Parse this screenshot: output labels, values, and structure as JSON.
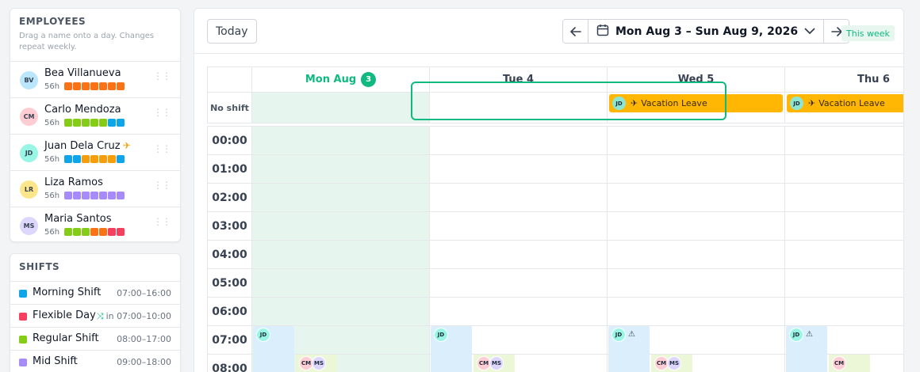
{
  "employees_panel": {
    "title": "EMPLOYEES",
    "subtitle": "Drag a name onto a day. Changes repeat weekly.",
    "items": [
      {
        "initials": "BV",
        "name": "Bea Villanueva",
        "hours": "56h",
        "avatar_color": "#bae6fd",
        "squares": [
          "#f97316",
          "#f97316",
          "#f97316",
          "#f97316",
          "#f97316",
          "#f97316",
          "#f97316"
        ],
        "on_leave": false
      },
      {
        "initials": "CM",
        "name": "Carlo Mendoza",
        "hours": "56h",
        "avatar_color": "#fecdd3",
        "squares": [
          "#84cc16",
          "#84cc16",
          "#84cc16",
          "#84cc16",
          "#84cc16",
          "#0ea5e9",
          "#0ea5e9"
        ],
        "on_leave": false
      },
      {
        "initials": "JD",
        "name": "Juan Dela Cruz",
        "hours": "56h",
        "avatar_color": "#99f6e4",
        "squares": [
          "#0ea5e9",
          "#0ea5e9",
          "#f59e0b",
          "#f59e0b",
          "#f59e0b",
          "#f59e0b",
          "#0ea5e9"
        ],
        "on_leave": true
      },
      {
        "initials": "LR",
        "name": "Liza Ramos",
        "hours": "56h",
        "avatar_color": "#fde68a",
        "squares": [
          "#a78bfa",
          "#a78bfa",
          "#a78bfa",
          "#a78bfa",
          "#a78bfa",
          "#a78bfa",
          "#a78bfa"
        ],
        "on_leave": false
      },
      {
        "initials": "MS",
        "name": "Maria Santos",
        "hours": "56h",
        "avatar_color": "#ddd6fe",
        "squares": [
          "#84cc16",
          "#84cc16",
          "#84cc16",
          "#f97316",
          "#f97316",
          "#f43f5e",
          "#f43f5e"
        ],
        "on_leave": false
      }
    ]
  },
  "shifts_panel": {
    "title": "SHIFTS",
    "items": [
      {
        "name": "Morning Shift",
        "time": "07:00–16:00",
        "color": "#0ea5e9",
        "flexible": false
      },
      {
        "name": "Flexible Day",
        "time": "in 07:00–10:00",
        "color": "#f43f5e",
        "flexible": true
      },
      {
        "name": "Regular Shift",
        "time": "08:00–17:00",
        "color": "#84cc16",
        "flexible": false
      },
      {
        "name": "Mid Shift",
        "time": "09:00–18:00",
        "color": "#a78bfa",
        "flexible": false
      }
    ]
  },
  "toolbar": {
    "today_label": "Today",
    "prev_icon": "arrow-left-icon",
    "next_icon": "arrow-right-icon",
    "range_label": "Mon Aug 3 – Sun Aug 9, 2026",
    "this_week_badge": "This week"
  },
  "calendar": {
    "days": [
      {
        "label": "Mon Aug",
        "count": "3",
        "today": true
      },
      {
        "label": "Tue 4",
        "today": false
      },
      {
        "label": "Wed 5",
        "today": false
      },
      {
        "label": "Thu 6",
        "today": false
      }
    ],
    "no_shift_label": "No shift",
    "vacation_label": "Vacation Leave",
    "vacation_initials": "JD",
    "hours": [
      "00:00",
      "01:00",
      "02:00",
      "03:00",
      "04:00",
      "05:00",
      "06:00",
      "07:00",
      "08:00"
    ],
    "colors": {
      "accent": "#10b981",
      "today_bg": "#e6f6ee",
      "vacation": "#ffb703",
      "morning_block": "#dbeefb",
      "regular_block": "#ecf7d8"
    }
  }
}
